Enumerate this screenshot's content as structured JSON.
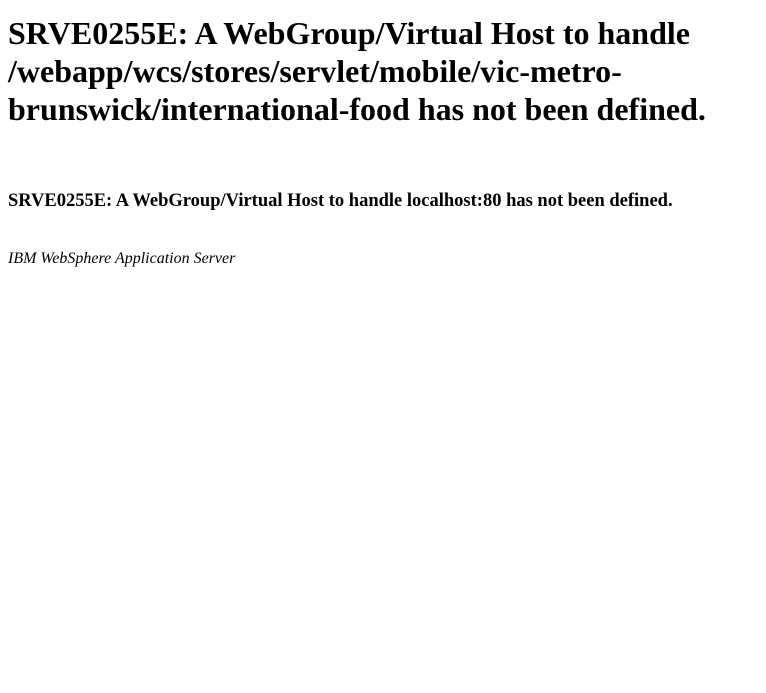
{
  "error_page": {
    "heading": "SRVE0255E: A WebGroup/Virtual Host to handle /webapp/wcs/stores/servlet/mobile/vic-metro-brunswick/international-food has not been defined.",
    "subheading": "SRVE0255E: A WebGroup/Virtual Host to handle localhost:80 has not been defined.",
    "server_signature": "IBM WebSphere Application Server"
  },
  "colors": {
    "background": "#ffffff",
    "text": "#000000"
  }
}
